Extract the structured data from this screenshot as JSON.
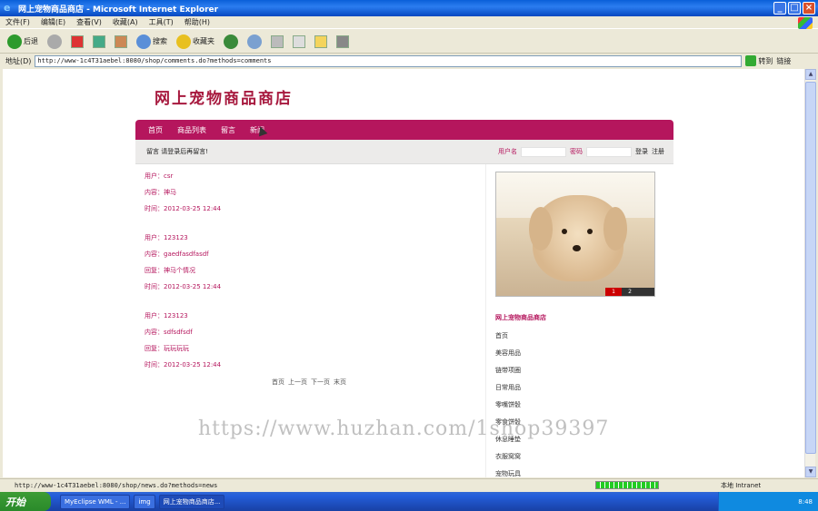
{
  "window": {
    "title": "网上宠物商品商店 - Microsoft Internet Explorer"
  },
  "menu": [
    "文件(F)",
    "编辑(E)",
    "查看(V)",
    "收藏(A)",
    "工具(T)",
    "帮助(H)"
  ],
  "toolbar": {
    "back": "后退",
    "search": "搜索",
    "favorites": "收藏夹"
  },
  "address": {
    "label": "地址(D)",
    "url": "http://www-1c4T31aebel:8080/shop/comments.do?methods=comments",
    "go": "转到",
    "links": "链接"
  },
  "page": {
    "logo": "网上宠物商品商店",
    "nav": [
      "首页",
      "商品列表",
      "留言",
      "新闻"
    ],
    "subbar_text": "留言 请登录后再留言!",
    "login": {
      "user_label": "用户名",
      "pass_label": "密码",
      "login": "登录",
      "register": "注册"
    },
    "comments": [
      {
        "user": "用户：csr",
        "content": "内容：神马",
        "reply": "",
        "time": "时间：2012-03-25 12:44"
      },
      {
        "user": "用户：123123",
        "content": "内容：gaedfasdfasdf",
        "reply": "回复：神马个情况",
        "time": "时间：2012-03-25 12:44"
      },
      {
        "user": "用户：123123",
        "content": "内容：sdfsdfsdf",
        "reply": "回复：玩玩玩玩",
        "time": "时间：2012-03-25 12:44"
      }
    ],
    "pager": [
      "首页",
      "上一页",
      "下一页",
      "末页"
    ],
    "slide_nav": [
      "1",
      "2"
    ],
    "side_title": "网上宠物商品商店",
    "side_links": [
      "首页",
      "美容用品",
      "链带项圈",
      "日常用品",
      "零嘴饼骰",
      "零食饼骰",
      "休息睡垫",
      "衣服窝窝",
      "宠物玩具"
    ]
  },
  "watermark": "https://www.huzhan.com/1shop39397",
  "status": {
    "url": "http://www-1c4T31aebel:8080/shop/news.do?methods=news",
    "zone": "本地 Intranet"
  },
  "taskbar": {
    "start": "开始",
    "tasks": [
      "MyEclipse WML - ...",
      "img",
      "网上宠物商品商店..."
    ],
    "clock": "8:48"
  }
}
